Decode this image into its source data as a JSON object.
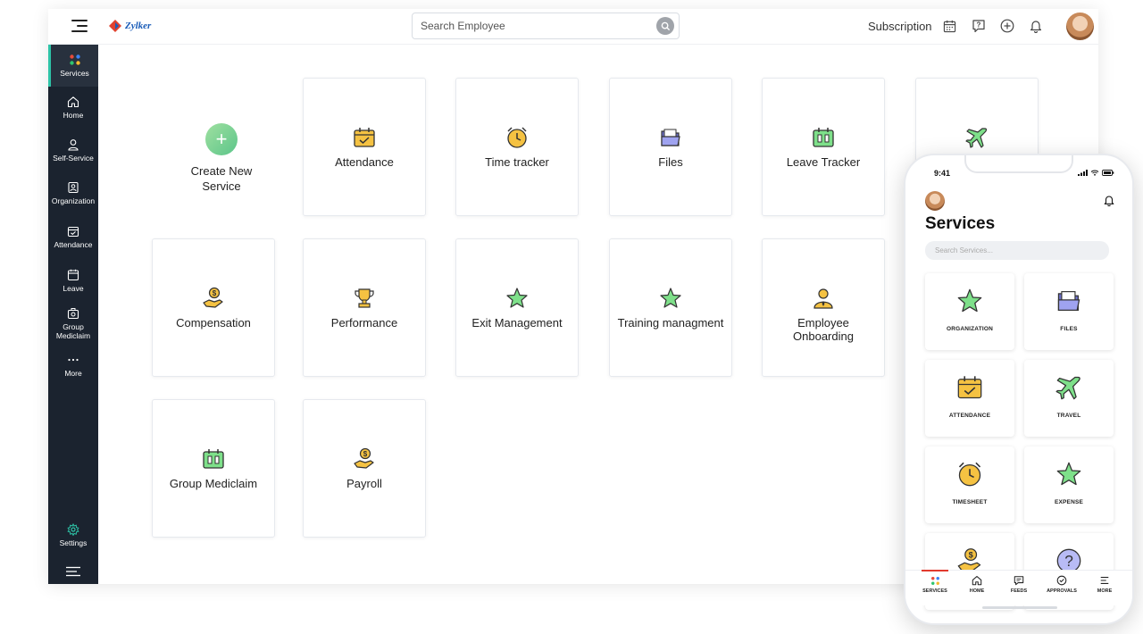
{
  "topbar": {
    "logo_text": "Zylker",
    "search_placeholder": "Search Employee",
    "subscription_label": "Subscription",
    "icons": [
      "calendar-icon",
      "help-icon",
      "add-icon",
      "bell-icon"
    ]
  },
  "sidebar": {
    "items": [
      {
        "label": "Services",
        "icon": "apps-icon",
        "active": true
      },
      {
        "label": "Home",
        "icon": "home-icon"
      },
      {
        "label": "Self-Service",
        "icon": "user-icon"
      },
      {
        "label": "Organization",
        "icon": "organization-icon"
      },
      {
        "label": "Attendance",
        "icon": "attendance-icon"
      },
      {
        "label": "Leave",
        "icon": "leave-icon"
      },
      {
        "label": "Group Mediclaim",
        "icon": "mediclaim-icon"
      },
      {
        "label": "More",
        "icon": "more-icon"
      }
    ],
    "settings_label": "Settings"
  },
  "main": {
    "create": {
      "label": "Create New Service"
    },
    "cards": [
      {
        "label": "Attendance",
        "icon": "attendance-icon"
      },
      {
        "label": "Time tracker",
        "icon": "clock-icon"
      },
      {
        "label": "Files",
        "icon": "folder-icon"
      },
      {
        "label": "Leave Tracker",
        "icon": "leave-tracker-icon"
      },
      {
        "label": "",
        "icon": "travel-icon"
      },
      {
        "label": "Compensation",
        "icon": "money-hand-icon"
      },
      {
        "label": "Performance",
        "icon": "trophy-icon"
      },
      {
        "label": "Exit Management",
        "icon": "star-icon"
      },
      {
        "label": "Training managment",
        "icon": "star-icon"
      },
      {
        "label": "Employee Onboarding",
        "icon": "employee-icon"
      },
      {
        "label": "Group Mediclaim",
        "icon": "mediclaim-icon"
      },
      {
        "label": "Payroll",
        "icon": "money-hand-icon"
      }
    ]
  },
  "phone": {
    "time": "9:41",
    "title": "Services",
    "search_placeholder": "Search Services...",
    "cards": [
      {
        "label": "ORGANIZATION",
        "icon": "star-icon"
      },
      {
        "label": "FILES",
        "icon": "folder-icon"
      },
      {
        "label": "ATTENDANCE",
        "icon": "attendance-icon"
      },
      {
        "label": "TRAVEL",
        "icon": "travel-icon"
      },
      {
        "label": "TIMESHEET",
        "icon": "clock-icon"
      },
      {
        "label": "EXPENSE",
        "icon": "star-icon"
      },
      {
        "label": "",
        "icon": "money-hand-icon"
      },
      {
        "label": "",
        "icon": "help-icon"
      }
    ],
    "nav": [
      {
        "label": "SERVICES",
        "icon": "apps-icon",
        "active": true
      },
      {
        "label": "HOME",
        "icon": "home-icon"
      },
      {
        "label": "FEEDS",
        "icon": "feeds-icon"
      },
      {
        "label": "APPROVALS",
        "icon": "approvals-icon"
      },
      {
        "label": "MORE",
        "icon": "more-icon"
      }
    ]
  },
  "colors": {
    "sidebar_bg": "#1b232f",
    "accent_green": "#2ec4a8",
    "icon_yellow": "#f5c242",
    "icon_green": "#7ee08a",
    "icon_purple": "#8a8de8",
    "nav_active_red": "#e23a2e"
  }
}
